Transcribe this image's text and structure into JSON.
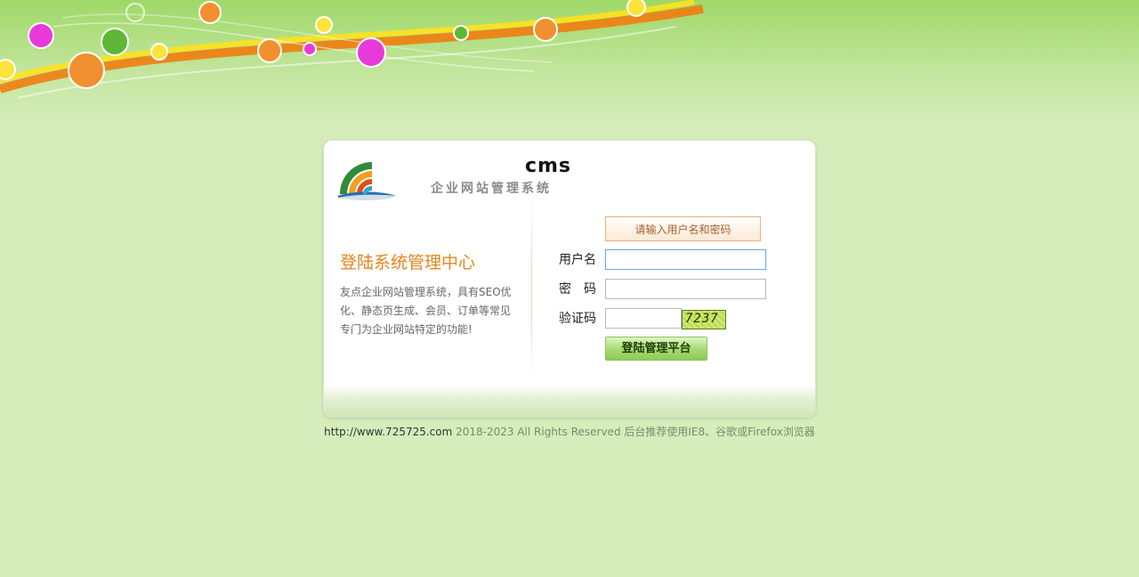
{
  "brand": {
    "cms": "cms",
    "subtitle": "企业网站管理系统"
  },
  "left": {
    "title": "登陆系统管理中心",
    "description": "友点企业网站管理系统，具有SEO优化、静态页生成、会员、订单等常见专门为企业网站特定的功能!"
  },
  "form": {
    "hint": "请输入用户名和密码",
    "username_label": "用户名",
    "password_label": "密　码",
    "captcha_label": "验证码",
    "username_value": "",
    "password_value": "",
    "captcha_value": "",
    "captcha_image_text": "7237",
    "submit_label": "登陆管理平台"
  },
  "footer": {
    "url": "http://www.725725.com",
    "text": " 2018-2023 All Rights Reserved 后台推荐使用IE8、谷歌或Firefox浏览器"
  },
  "colors": {
    "background": "#d5edbb",
    "accent_orange": "#e88418",
    "button_green": "#a9dc75"
  }
}
